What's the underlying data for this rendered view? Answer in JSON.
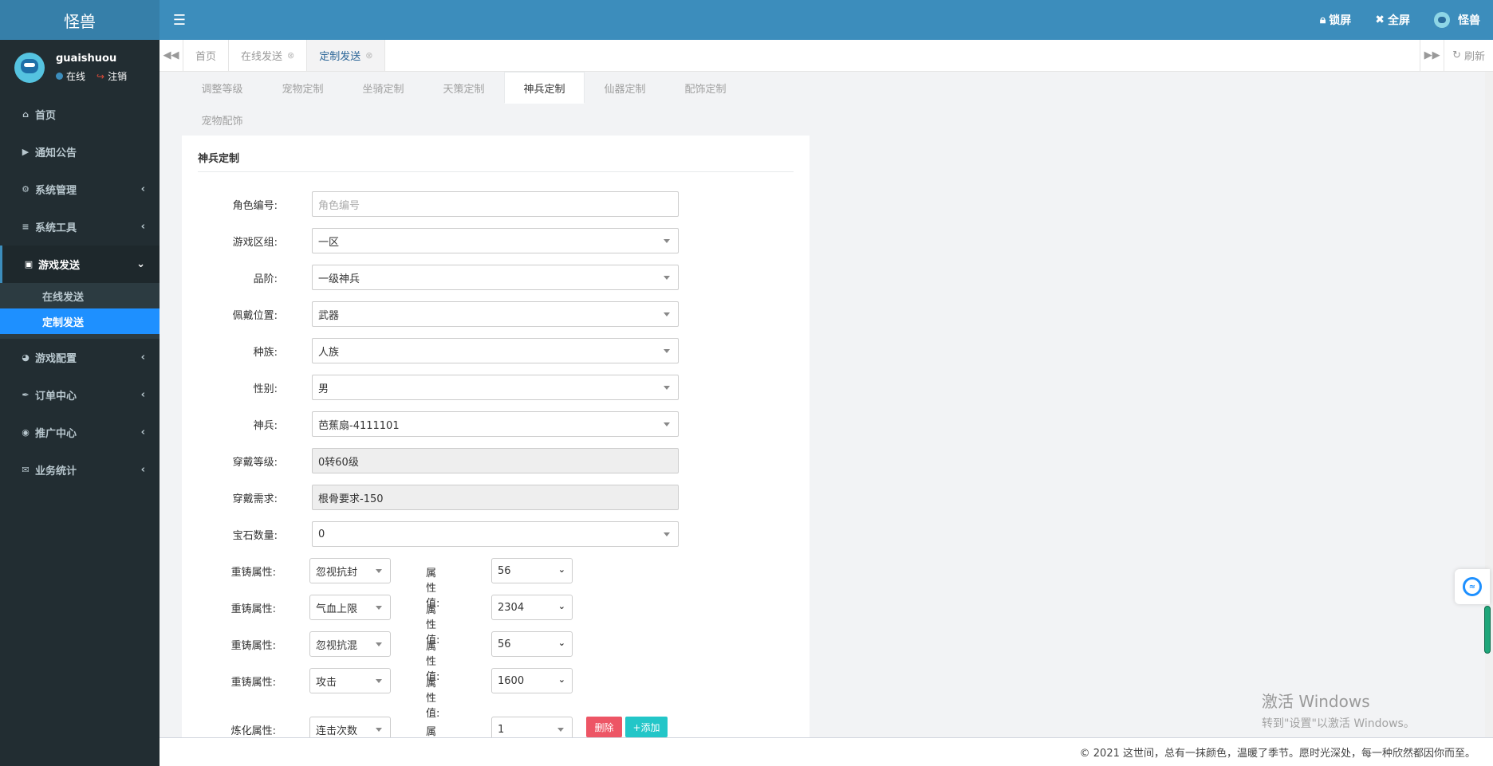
{
  "app": {
    "logo": "怪兽"
  },
  "header": {
    "menu_icon": "hamburger-icon",
    "lock_label": "锁屏",
    "fullscreen_label": "全屏",
    "user_label": "怪兽"
  },
  "user": {
    "name": "guaishuou",
    "status": "在线",
    "logout": "注销"
  },
  "sidebar": {
    "items": [
      {
        "label": "首页",
        "icon": "home-icon"
      },
      {
        "label": "通知公告",
        "icon": "bullhorn-icon"
      },
      {
        "label": "系统管理",
        "icon": "gear-icon"
      },
      {
        "label": "系统工具",
        "icon": "bars-icon"
      },
      {
        "label": "游戏发送",
        "icon": "gift-icon"
      },
      {
        "label": "游戏配置",
        "icon": "dashboard-icon"
      },
      {
        "label": "订单中心",
        "icon": "paint-brush-icon"
      },
      {
        "label": "推广中心",
        "icon": "eye-icon"
      },
      {
        "label": "业务统计",
        "icon": "envelope-icon"
      }
    ],
    "submenu": [
      "在线发送",
      "定制发送"
    ]
  },
  "tabs": {
    "items": [
      "首页",
      "在线发送",
      "定制发送"
    ],
    "refresh": "刷新"
  },
  "subtabs": [
    "调整等级",
    "宠物定制",
    "坐骑定制",
    "天策定制",
    "神兵定制",
    "仙器定制",
    "配饰定制",
    "宠物配饰"
  ],
  "panel": {
    "title": "神兵定制"
  },
  "form": {
    "role_id": {
      "label": "角色编号:",
      "placeholder": "角色编号"
    },
    "server": {
      "label": "游戏区组:",
      "value": "一区"
    },
    "grade": {
      "label": "品阶:",
      "value": "一级神兵"
    },
    "slot": {
      "label": "佩戴位置:",
      "value": "武器"
    },
    "race": {
      "label": "种族:",
      "value": "人族"
    },
    "gender": {
      "label": "性别:",
      "value": "男"
    },
    "weapon": {
      "label": "神兵:",
      "value": "芭蕉扇-4111101"
    },
    "wear_level": {
      "label": "穿戴等级:",
      "value": "0转60级"
    },
    "wear_req": {
      "label": "穿戴需求:",
      "value": "根骨要求-150"
    },
    "gem_count": {
      "label": "宝石数量:",
      "value": "0"
    },
    "recast_label": "重铸属性:",
    "attr_value_label": "属性值:",
    "recast": [
      {
        "attr": "忽视抗封",
        "value": "56"
      },
      {
        "attr": "气血上限",
        "value": "2304"
      },
      {
        "attr": "忽视抗混",
        "value": "56"
      },
      {
        "attr": "攻击",
        "value": "1600"
      }
    ],
    "refine_label": "炼化属性:",
    "refine": {
      "attr": "连击次数",
      "value": "1"
    },
    "delete_button": "删除",
    "add_button": "+添加"
  },
  "watermark": {
    "line1": "激活 Windows",
    "line2": "转到\"设置\"以激活 Windows。"
  },
  "footer": {
    "text": "© 2021 这世间，总有一抹颜色，温暖了季节。愿时光深处，每一种欣然都因你而至。"
  }
}
